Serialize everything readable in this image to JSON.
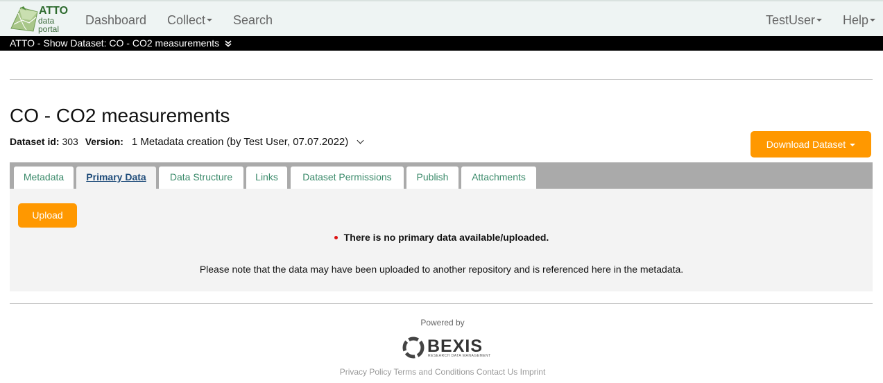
{
  "app": {
    "logo_title": "ATTO",
    "logo_line1": "data",
    "logo_line2": "portal"
  },
  "nav": {
    "dashboard": "Dashboard",
    "collect": "Collect",
    "search": "Search",
    "user": "TestUser",
    "help": "Help"
  },
  "breadcrumb": {
    "text": "ATTO - Show Dataset: CO - CO2 measurements",
    "icon": "double-chevron-down-icon"
  },
  "dataset": {
    "title": "CO - CO2 measurements",
    "id_label": "Dataset id:",
    "id_value": "303",
    "version_label": "Version:",
    "version_value": "1 Metadata creation (by Test User, 07.07.2022)"
  },
  "download_button": "Download Dataset",
  "tabs": [
    {
      "label": "Metadata",
      "active": false
    },
    {
      "label": "Primary Data",
      "active": true
    },
    {
      "label": "Data Structure",
      "active": false
    },
    {
      "label": "Links",
      "active": false
    },
    {
      "label": "Dataset Permissions",
      "active": false
    },
    {
      "label": "Publish",
      "active": false
    },
    {
      "label": "Attachments",
      "active": false
    }
  ],
  "primary_data": {
    "upload_button": "Upload",
    "no_data_message": "There is no primary data available/uploaded.",
    "note": "Please note that the data may have been uploaded to another repository and is referenced here in the metadata."
  },
  "footer": {
    "powered_by": "Powered by",
    "brand": "BEXIS",
    "brand_sub": "RESEARCH DATA MANAGEMENT",
    "links": [
      "Privacy Policy",
      "Terms and Conditions",
      "Contact Us",
      "Imprint"
    ]
  },
  "colors": {
    "accent_orange": "#ff9800",
    "tab_text": "#3a8a6a",
    "active_tab_text": "#1f4c7a",
    "breadcrumb_bg": "#000000"
  }
}
